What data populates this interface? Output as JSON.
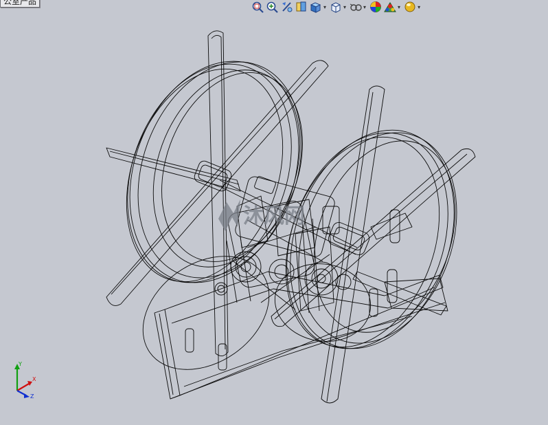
{
  "document": {
    "tag_text": "公室产品"
  },
  "watermark": {
    "text": "沐风网"
  },
  "heads_up_toolbar": {
    "tools": [
      {
        "name": "zoom-to-fit-icon"
      },
      {
        "name": "zoom-to-area-icon"
      },
      {
        "name": "previous-view-icon"
      },
      {
        "name": "section-view-icon"
      },
      {
        "name": "view-orientation-icon",
        "has_dropdown": true
      },
      {
        "name": "display-style-icon",
        "has_dropdown": true
      },
      {
        "name": "hide-show-items-icon",
        "has_dropdown": true
      },
      {
        "name": "edit-appearance-icon"
      },
      {
        "name": "apply-scene-icon",
        "has_dropdown": true
      },
      {
        "name": "view-settings-icon",
        "has_dropdown": true
      }
    ]
  },
  "triad": {
    "x_label": "X",
    "y_label": "Y",
    "z_label": "Z",
    "colors": {
      "x": "#d01010",
      "y": "#10a010",
      "z": "#1030d0"
    }
  },
  "colors": {
    "background": "#c5c8d0",
    "wireframe": "#0a0a0a"
  }
}
